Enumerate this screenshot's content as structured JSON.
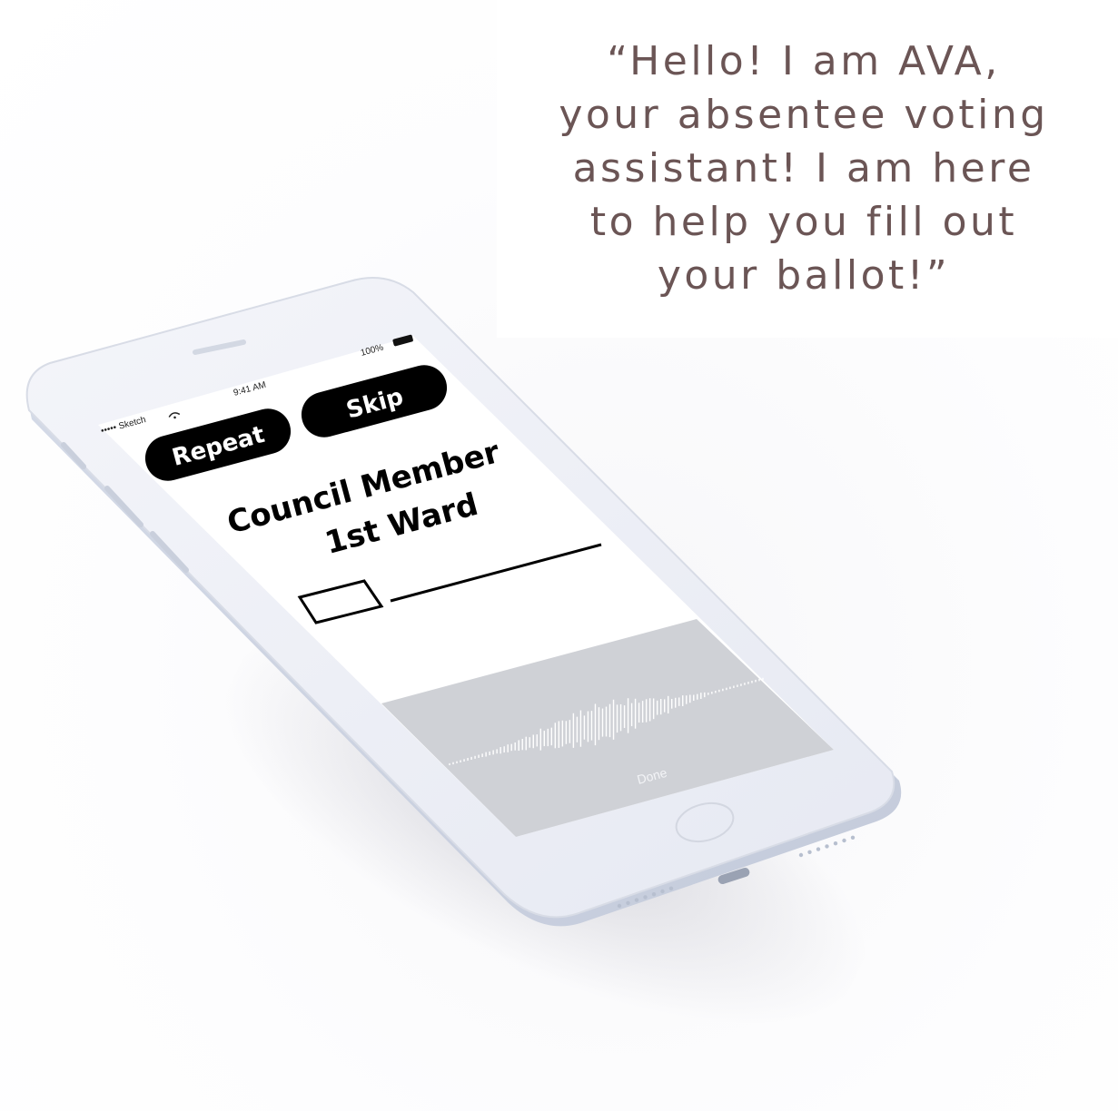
{
  "quote": {
    "lines": [
      "“Hello! I am AVA,",
      "your absentee voting",
      "assistant! I am here",
      "to help you fill out",
      "your ballot!”"
    ]
  },
  "status_bar": {
    "carrier": "••••• Sketch",
    "time": "9:41 AM",
    "battery": "100%"
  },
  "buttons": {
    "repeat": "Repeat",
    "skip": "Skip"
  },
  "ballot": {
    "title_line1": "Council Member",
    "title_line2": "1st Ward"
  },
  "voice_panel": {
    "done_label": "Done",
    "waveform_level": 0.6
  },
  "colors": {
    "quote_text": "#6b5555",
    "button_bg": "#000000",
    "panel_bg": "#cfd1d6",
    "phone_body": "#eef0f6"
  }
}
